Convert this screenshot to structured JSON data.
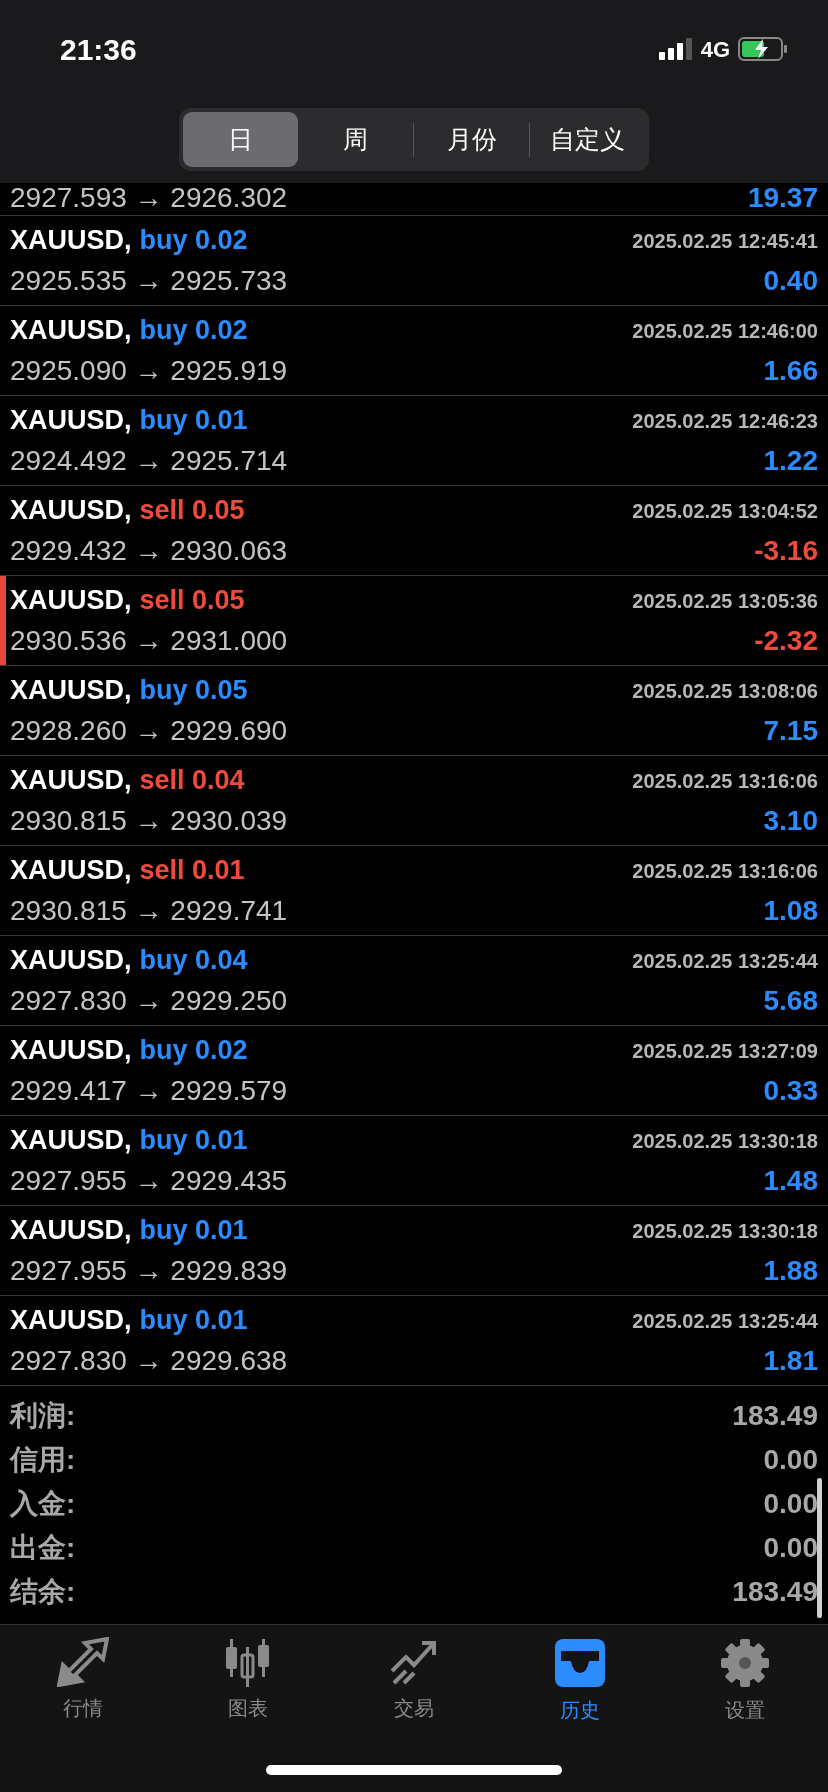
{
  "status_bar": {
    "time": "21:36",
    "network": "4G"
  },
  "period_tabs": [
    {
      "label": "日",
      "selected": true
    },
    {
      "label": "周",
      "selected": false
    },
    {
      "label": "月份",
      "selected": false
    },
    {
      "label": "自定义",
      "selected": false
    }
  ],
  "deals": [
    {
      "prices": "2927.593 → 2926.302",
      "profit": "19.37",
      "loss": false,
      "selected": false
    },
    {
      "symbol": "XAUUSD,",
      "side": "buy",
      "volume": "0.02",
      "time": "2025.02.25 12:45:41",
      "prices": "2925.535 → 2925.733",
      "profit": "0.40",
      "loss": false,
      "selected": false
    },
    {
      "symbol": "XAUUSD,",
      "side": "buy",
      "volume": "0.02",
      "time": "2025.02.25 12:46:00",
      "prices": "2925.090 → 2925.919",
      "profit": "1.66",
      "loss": false,
      "selected": false
    },
    {
      "symbol": "XAUUSD,",
      "side": "buy",
      "volume": "0.01",
      "time": "2025.02.25 12:46:23",
      "prices": "2924.492 → 2925.714",
      "profit": "1.22",
      "loss": false,
      "selected": false
    },
    {
      "symbol": "XAUUSD,",
      "side": "sell",
      "volume": "0.05",
      "time": "2025.02.25 13:04:52",
      "prices": "2929.432 → 2930.063",
      "profit": "-3.16",
      "loss": true,
      "selected": false
    },
    {
      "symbol": "XAUUSD,",
      "side": "sell",
      "volume": "0.05",
      "time": "2025.02.25 13:05:36",
      "prices": "2930.536 → 2931.000",
      "profit": "-2.32",
      "loss": true,
      "selected": true
    },
    {
      "symbol": "XAUUSD,",
      "side": "buy",
      "volume": "0.05",
      "time": "2025.02.25 13:08:06",
      "prices": "2928.260 → 2929.690",
      "profit": "7.15",
      "loss": false,
      "selected": false
    },
    {
      "symbol": "XAUUSD,",
      "side": "sell",
      "volume": "0.04",
      "time": "2025.02.25 13:16:06",
      "prices": "2930.815 → 2930.039",
      "profit": "3.10",
      "loss": false,
      "selected": false
    },
    {
      "symbol": "XAUUSD,",
      "side": "sell",
      "volume": "0.01",
      "time": "2025.02.25 13:16:06",
      "prices": "2930.815 → 2929.741",
      "profit": "1.08",
      "loss": false,
      "selected": false
    },
    {
      "symbol": "XAUUSD,",
      "side": "buy",
      "volume": "0.04",
      "time": "2025.02.25 13:25:44",
      "prices": "2927.830 → 2929.250",
      "profit": "5.68",
      "loss": false,
      "selected": false
    },
    {
      "symbol": "XAUUSD,",
      "side": "buy",
      "volume": "0.02",
      "time": "2025.02.25 13:27:09",
      "prices": "2929.417 → 2929.579",
      "profit": "0.33",
      "loss": false,
      "selected": false
    },
    {
      "symbol": "XAUUSD,",
      "side": "buy",
      "volume": "0.01",
      "time": "2025.02.25 13:30:18",
      "prices": "2927.955 → 2929.435",
      "profit": "1.48",
      "loss": false,
      "selected": false
    },
    {
      "symbol": "XAUUSD,",
      "side": "buy",
      "volume": "0.01",
      "time": "2025.02.25 13:30:18",
      "prices": "2927.955 → 2929.839",
      "profit": "1.88",
      "loss": false,
      "selected": false
    },
    {
      "symbol": "XAUUSD,",
      "side": "buy",
      "volume": "0.01",
      "time": "2025.02.25 13:25:44",
      "prices": "2927.830 → 2929.638",
      "profit": "1.81",
      "loss": false,
      "selected": false
    }
  ],
  "summary": [
    {
      "label": "利润:",
      "value": "183.49"
    },
    {
      "label": "信用:",
      "value": "0.00"
    },
    {
      "label": "入金:",
      "value": "0.00"
    },
    {
      "label": "出金:",
      "value": "0.00"
    },
    {
      "label": "结余:",
      "value": "183.49"
    }
  ],
  "bottom_tabs": [
    {
      "kind": "quotes",
      "label": "行情",
      "selected": false
    },
    {
      "kind": "chart",
      "label": "图表",
      "selected": false
    },
    {
      "kind": "trade",
      "label": "交易",
      "selected": false
    },
    {
      "kind": "history",
      "label": "历史",
      "selected": true
    },
    {
      "kind": "settings",
      "label": "设置",
      "selected": false
    }
  ]
}
